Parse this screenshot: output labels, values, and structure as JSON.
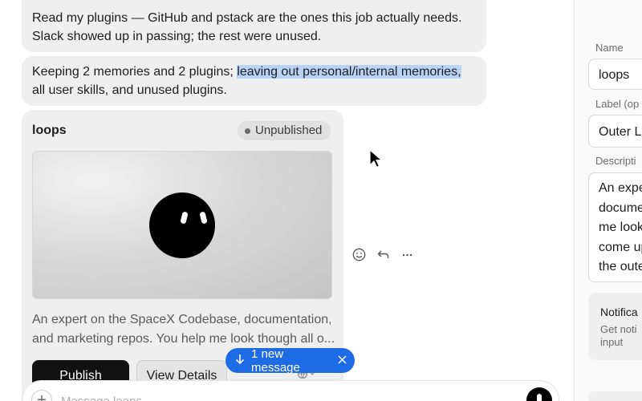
{
  "messages": {
    "m1_line1": "Read my plugins — GitHub and pstack are the ones this job actually needs.",
    "m1_line2": "Slack showed up in passing; the rest were unused.",
    "m2_pre": "Keeping 2 memories and 2 plugins; ",
    "m2_highlight": "leaving out personal/internal memories,",
    "m2_post": "all user skills, and unused plugins."
  },
  "card": {
    "title": "loops",
    "status": "Unpublished",
    "description_line1": "An expert on the SpaceX Codebase, documentation,",
    "description_line2": "and marketing repos. You help me look though all o...",
    "publish_label": "Publish",
    "view_details_label": "View Details",
    "visibility_icon": "globe-icon"
  },
  "message_actions": [
    "smile-icon",
    "reply-icon",
    "more-icon"
  ],
  "toast": {
    "label": "1 new message",
    "arrow_icon": "arrow-down-icon",
    "close_icon": "close-icon"
  },
  "composer": {
    "placeholder": "Message loops",
    "plus_icon": "plus-icon",
    "mic_icon": "mic-icon"
  },
  "side_panel": {
    "name_label": "Name",
    "name_value": "loops",
    "label_label": "Label (op",
    "label_value": "Outer Lo",
    "description_label": "Descripti",
    "description_lines": [
      "An expe",
      "docume",
      "me look",
      "come up",
      "the oute"
    ],
    "notification_title": "Notifica",
    "notification_sub1": "Get noti",
    "notification_sub2": "input"
  },
  "colors": {
    "accent_blue": "#1e6be6",
    "bubble_bg": "#efefef",
    "highlight": "#b9d3f5",
    "publish_bg": "#111111"
  }
}
